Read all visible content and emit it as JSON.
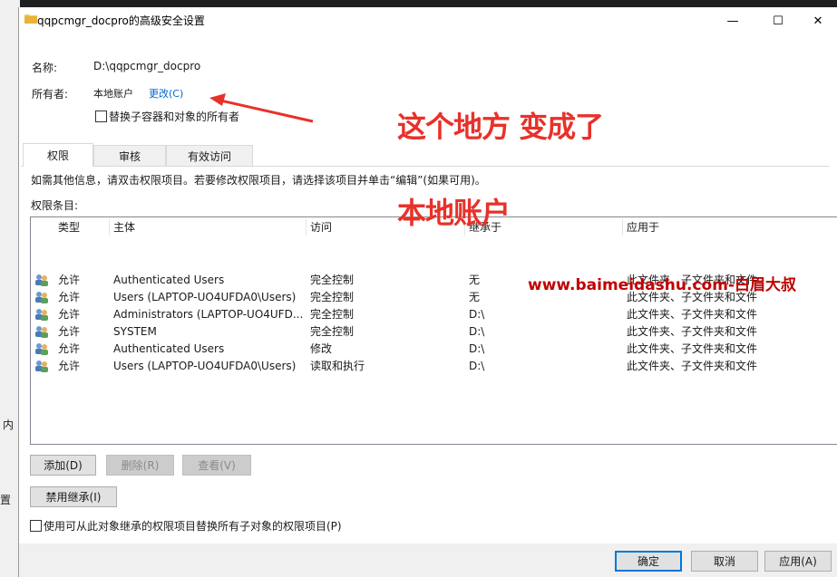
{
  "window": {
    "title": "qqpcmgr_docpro的高级安全设置",
    "controls": {
      "minimize": "—",
      "maximize": "☐",
      "close": "✕"
    }
  },
  "background": {
    "fragment_1": "内",
    "fragment_2": "置"
  },
  "header": {
    "name_label": "名称:",
    "name_value": "D:\\qqpcmgr_docpro",
    "owner_label": "所有者:",
    "owner_value": "本地账户",
    "owner_change": "更改(C)",
    "replace_owner_label": "替换子容器和对象的所有者"
  },
  "tabs": [
    {
      "label": "权限",
      "active": true
    },
    {
      "label": "审核",
      "active": false
    },
    {
      "label": "有效访问",
      "active": false
    }
  ],
  "info_text": "如需其他信息，请双击权限项目。若要修改权限项目，请选择该项目并单击“编辑”(如果可用)。",
  "entries_label": "权限条目:",
  "columns": {
    "type": "类型",
    "principal": "主体",
    "access": "访问",
    "inherited": "继承于",
    "applies": "应用于"
  },
  "entries": [
    {
      "type": "允许",
      "principal": "Authenticated Users",
      "access": "完全控制",
      "inherited": "无",
      "applies": "此文件夹、子文件夹和文件"
    },
    {
      "type": "允许",
      "principal": "Users (LAPTOP-UO4UFDA0\\Users)",
      "access": "完全控制",
      "inherited": "无",
      "applies": "此文件夹、子文件夹和文件"
    },
    {
      "type": "允许",
      "principal": "Administrators (LAPTOP-UO4UFD...",
      "access": "完全控制",
      "inherited": "D:\\",
      "applies": "此文件夹、子文件夹和文件"
    },
    {
      "type": "允许",
      "principal": "SYSTEM",
      "access": "完全控制",
      "inherited": "D:\\",
      "applies": "此文件夹、子文件夹和文件"
    },
    {
      "type": "允许",
      "principal": "Authenticated Users",
      "access": "修改",
      "inherited": "D:\\",
      "applies": "此文件夹、子文件夹和文件"
    },
    {
      "type": "允许",
      "principal": "Users (LAPTOP-UO4UFDA0\\Users)",
      "access": "读取和执行",
      "inherited": "D:\\",
      "applies": "此文件夹、子文件夹和文件"
    }
  ],
  "buttons": {
    "add": "添加(D)",
    "remove": "删除(R)",
    "view": "查看(V)",
    "disable_inherit": "禁用继承(I)",
    "ok": "确定",
    "cancel": "取消",
    "apply": "应用(A)"
  },
  "replace_child_label": "使用可从此对象继承的权限项目替换所有子对象的权限项目(P)",
  "annotations": {
    "line_1": "这个地方 变成了",
    "line_2": "本地账户",
    "watermark": "www.baimeidashu.com-白眉大叔",
    "color": "#e8312a"
  },
  "icons": {
    "title": "folder-icon",
    "entry": "user-group-icon"
  }
}
